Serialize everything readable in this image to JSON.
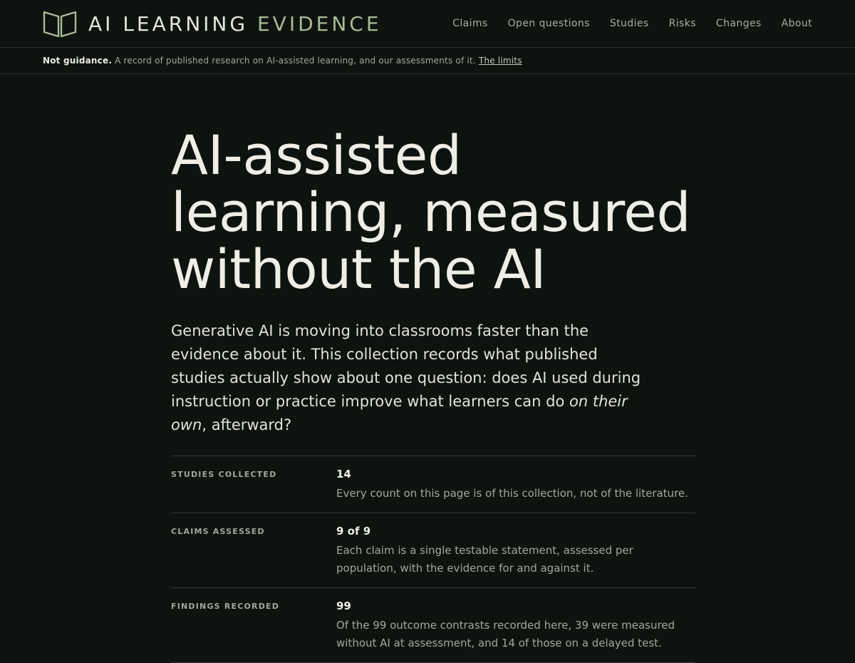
{
  "header": {
    "brand_word1": "AI LEARNING",
    "brand_word2": "EVIDENCE",
    "logo_icon": "open-book-icon",
    "nav": [
      {
        "label": "Claims"
      },
      {
        "label": "Open questions"
      },
      {
        "label": "Studies"
      },
      {
        "label": "Risks"
      },
      {
        "label": "Changes"
      },
      {
        "label": "About"
      }
    ]
  },
  "notice": {
    "strong": "Not guidance.",
    "text": "A record of published research on AI-assisted learning, and our assessments of it.",
    "link": "The limits"
  },
  "hero": {
    "title": "AI-assisted learning, measured without the AI",
    "lede_main": "Generative AI is moving into classrooms faster than the evidence about it. This collection records what published studies actually show about one question: does AI used during instruction or practice improve what learners can do ",
    "lede_em": "on their own",
    "lede_end": ", afterward?"
  },
  "stats": [
    {
      "label": "STUDIES COLLECTED",
      "value": "14",
      "desc": "Every count on this page is of this collection, not of the literature."
    },
    {
      "label": "CLAIMS ASSESSED",
      "value": "9 of 9",
      "desc": "Each claim is a single testable statement, assessed per population, with the evidence for and against it."
    },
    {
      "label": "FINDINGS RECORDED",
      "value": "99",
      "desc": "Of the 99 outcome contrasts recorded here, 39 were measured without AI at assessment, and 14 of those on a delayed test."
    }
  ],
  "colors": {
    "background": "#0e130f",
    "accent": "#a8bb96",
    "text": "#ecebe1",
    "muted": "#a4a79e"
  }
}
